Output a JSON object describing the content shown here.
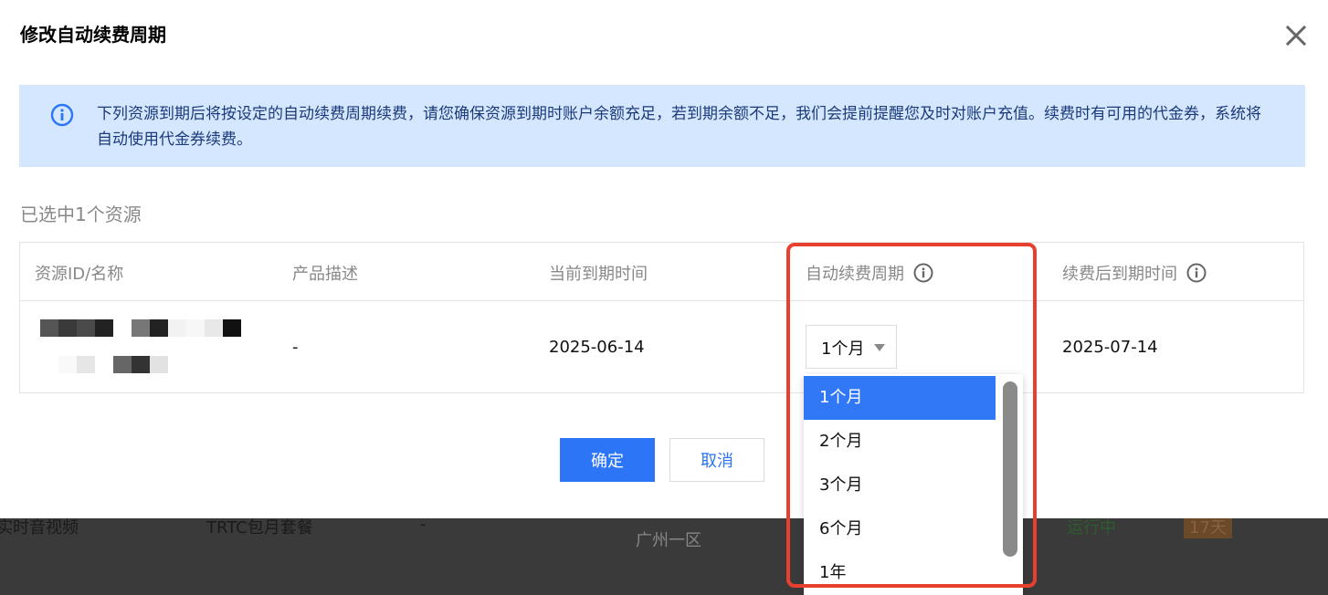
{
  "dialog": {
    "title": "修改自动续费周期",
    "close_icon": "close-icon",
    "notice": {
      "icon": "info-icon",
      "text": "下列资源到期后将按设定的自动续费周期续费，请您确保资源到期时账户余额充足，若到期余额不足，我们会提前提醒您及时对账户充值。续费时有可用的代金券，系统将自动使用代金券续费。"
    },
    "selected_count": "已选中1个资源",
    "table": {
      "headers": {
        "resource": "资源ID/名称",
        "product": "产品描述",
        "current_expiry": "当前到期时间",
        "renew_period": "自动续费周期",
        "new_expiry": "续费后到期时间"
      },
      "row": {
        "product": "-",
        "current_expiry": "2025-06-14",
        "renew_period": "1个月",
        "new_expiry": "2025-07-14"
      }
    },
    "dropdown": {
      "options": [
        "1个月",
        "2个月",
        "3个月",
        "6个月",
        "1年"
      ],
      "selected": "1个月"
    },
    "buttons": {
      "ok": "确定",
      "cancel": "取消"
    }
  },
  "background": {
    "row": {
      "name": "实时音视频",
      "product": "TRTC包月套餐",
      "dash": "-",
      "region": "广州一区",
      "status": "运行中",
      "days": "17天"
    }
  },
  "colors": {
    "primary": "#2b75f6",
    "notice_bg": "#d5e7ff",
    "highlight": "#e8402e"
  }
}
